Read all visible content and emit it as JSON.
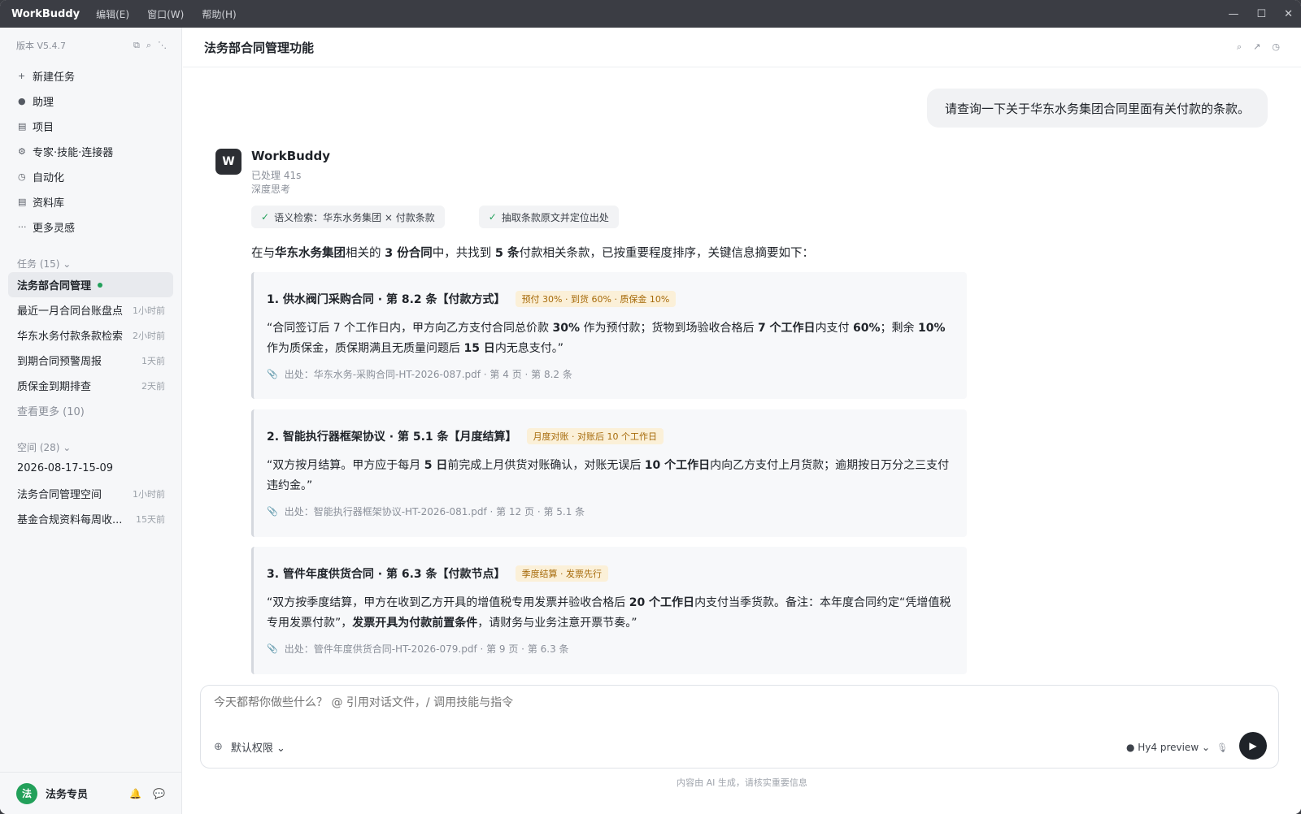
{
  "titlebar": {
    "app": "WorkBuddy",
    "menus": [
      "编辑(E)",
      "窗口(W)",
      "帮助(H)"
    ],
    "controls": [
      "—",
      "☐",
      "✕"
    ]
  },
  "sidebar": {
    "version": "版本 V5.4.7",
    "nav": [
      {
        "icon": "plus-icon",
        "glyph": "+",
        "label": "新建任务"
      },
      {
        "icon": "dot-icon",
        "glyph": "●",
        "label": "助理"
      },
      {
        "icon": "list-icon",
        "glyph": "▤",
        "label": "项目"
      },
      {
        "icon": "gear-icon",
        "glyph": "⚙",
        "label": "专家·技能·连接器"
      },
      {
        "icon": "clock-icon",
        "glyph": "◷",
        "label": "自动化"
      },
      {
        "icon": "library-icon",
        "glyph": "▤",
        "label": "资料库"
      },
      {
        "icon": "more-icon",
        "glyph": "···",
        "label": "更多灵感"
      }
    ],
    "tasks_title": "任务 (15) ⌄",
    "active_task": "法务部合同管理",
    "tasks": [
      {
        "name": "最近一月合同台账盘点",
        "time": "1小时前"
      },
      {
        "name": "华东水务付款条款检索",
        "time": "2小时前"
      },
      {
        "name": "到期合同预警周报",
        "time": "1天前"
      },
      {
        "name": "质保金到期排查",
        "time": "2天前"
      }
    ],
    "see_more": "查看更多 (10)",
    "spaces_title": "空间 (28) ⌄",
    "spaces": [
      {
        "name": "2026-08-17-15-09",
        "time": ""
      },
      {
        "name": "法务合同管理空间",
        "time": "1小时前"
      },
      {
        "name": "基金合规资料每周收...",
        "time": "15天前"
      }
    ],
    "user": {
      "avatar": "法",
      "name": "法务专员"
    }
  },
  "main": {
    "title": "法务部合同管理功能",
    "user_message": "请查询一下关于华东水务集团合同里面有关付款的条款。",
    "bot": {
      "avatar": "W",
      "name": "WorkBuddy",
      "processed": "已处理 41s",
      "mode": "深度思考"
    },
    "chips": [
      "语义检索：华东水务集团 × 付款条款",
      "抽取条款原文并定位出处"
    ],
    "summary": {
      "p1": "在与",
      "b1": "华东水务集团",
      "p2": "相关的 ",
      "b2": "3 份合同",
      "p3": "中，共找到 ",
      "b3": "5 条",
      "p4": "付款相关条款，已按重要程度排序，关键信息摘要如下："
    },
    "cards": [
      {
        "title": "1. 供水阀门采购合同 · 第 8.2 条【付款方式】",
        "tag": "预付 30% · 到货 60% · 质保金 10%",
        "q": [
          "“合同签订后 7 个工作日内，甲方向乙方支付合同总价款 ",
          "30%",
          " 作为预付款；货物到场验收合格后 ",
          "7 个工作日",
          "内支付 ",
          "60%",
          "；剩余 ",
          "10%",
          " 作为质保金，质保期满且无质量问题后 ",
          "15 日",
          "内无息支付。”"
        ],
        "source": "出处：华东水务-采购合同-HT-2026-087.pdf · 第 4 页 · 第 8.2 条"
      },
      {
        "title": "2. 智能执行器框架协议 · 第 5.1 条【月度结算】",
        "tag": "月度对账 · 对账后 10 个工作日",
        "q": [
          "“双方按月结算。甲方应于每月 ",
          "5 日",
          "前完成上月供货对账确认，对账无误后 ",
          "10 个工作日",
          "内向乙方支付上月货款；逾期按日万分之三支付违约金。”"
        ],
        "source": "出处：智能执行器框架协议-HT-2026-081.pdf · 第 12 页 · 第 5.1 条"
      },
      {
        "title": "3. 管件年度供货合同 · 第 6.3 条【付款节点】",
        "tag": "季度结算 · 发票先行",
        "q": [
          "“双方按季度结算，甲方在收到乙方开具的增值税专用发票并验收合格后 ",
          "20 个工作日",
          "内支付当季货款。备注：本年度合同约定“凭增值税专用发票付款”，",
          "发票开具为付款前置条件",
          "，请财务与业务注意开票节奏。”"
        ],
        "source": "出处：管件年度供货合同-HT-2026-079.pdf · 第 9 页 · 第 6.3 条"
      }
    ]
  },
  "composer": {
    "placeholder": "今天都帮你做些什么？ @ 引用对话文件，/ 调用技能与指令",
    "permission": "默认权限 ⌄",
    "model": "● Hy4 preview ⌄",
    "disclaimer": "内容由 AI 生成，请核实重要信息"
  }
}
